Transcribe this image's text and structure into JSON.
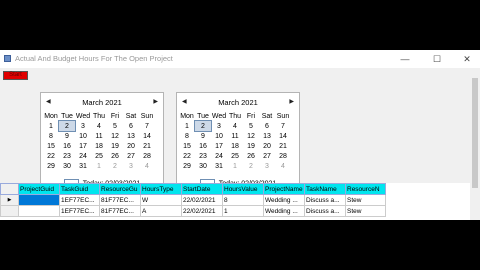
{
  "window": {
    "title": "Actual And Budget Hours For The Open Project",
    "minimize": "—",
    "maximize": "☐",
    "close": "✕"
  },
  "toolbar": {
    "red_button_label": "Start"
  },
  "calendars": [
    {
      "month": "March 2021",
      "today": "Today: 02/03/2021",
      "days": [
        "Mon",
        "Tue",
        "Wed",
        "Thu",
        "Fri",
        "Sat",
        "Sun"
      ],
      "weeks": [
        [
          "1",
          "2",
          "3",
          "4",
          "5",
          "6",
          "7"
        ],
        [
          "8",
          "9",
          "10",
          "11",
          "12",
          "13",
          "14"
        ],
        [
          "15",
          "16",
          "17",
          "18",
          "19",
          "20",
          "21"
        ],
        [
          "22",
          "23",
          "24",
          "25",
          "26",
          "27",
          "28"
        ],
        [
          "29",
          "30",
          "31",
          "1",
          "2",
          "3",
          "4"
        ]
      ]
    },
    {
      "month": "March 2021",
      "today": "Today: 02/03/2021",
      "days": [
        "Mon",
        "Tue",
        "Wed",
        "Thu",
        "Fri",
        "Sat",
        "Sun"
      ],
      "weeks": [
        [
          "1",
          "2",
          "3",
          "4",
          "5",
          "6",
          "7"
        ],
        [
          "8",
          "9",
          "10",
          "11",
          "12",
          "13",
          "14"
        ],
        [
          "15",
          "16",
          "17",
          "18",
          "19",
          "20",
          "21"
        ],
        [
          "22",
          "23",
          "24",
          "25",
          "26",
          "27",
          "28"
        ],
        [
          "29",
          "30",
          "31",
          "1",
          "2",
          "3",
          "4"
        ]
      ]
    }
  ],
  "grid": {
    "columns": [
      "ProjectGuid",
      "TaskGuid",
      "ResourceGu",
      "HoursType",
      "StartDate",
      "HoursValue",
      "ProjectName",
      "TaskName",
      "ResourceN"
    ],
    "rows": [
      [
        "",
        "1EF77EC...",
        "81F77EC...",
        "W",
        "22/02/2021",
        "8",
        "Wedding ...",
        "Discuss a...",
        "Stew"
      ],
      [
        "",
        "1EF77EC...",
        "81F77EC...",
        "A",
        "22/02/2021",
        "1",
        "Wedding ...",
        "Discuss a...",
        "Stew"
      ]
    ]
  }
}
